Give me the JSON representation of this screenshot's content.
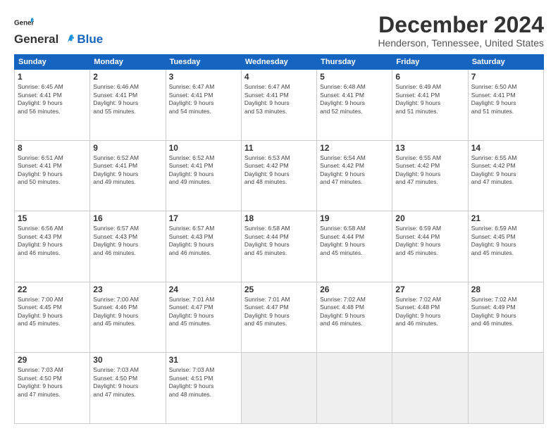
{
  "logo": {
    "general": "General",
    "blue": "Blue"
  },
  "title": {
    "month": "December 2024",
    "location": "Henderson, Tennessee, United States"
  },
  "weekdays": [
    "Sunday",
    "Monday",
    "Tuesday",
    "Wednesday",
    "Thursday",
    "Friday",
    "Saturday"
  ],
  "weeks": [
    [
      {
        "day": "1",
        "sunrise": "Sunrise: 6:45 AM",
        "sunset": "Sunset: 4:41 PM",
        "daylight": "Daylight: 9 hours and 56 minutes."
      },
      {
        "day": "2",
        "sunrise": "Sunrise: 6:46 AM",
        "sunset": "Sunset: 4:41 PM",
        "daylight": "Daylight: 9 hours and 55 minutes."
      },
      {
        "day": "3",
        "sunrise": "Sunrise: 6:47 AM",
        "sunset": "Sunset: 4:41 PM",
        "daylight": "Daylight: 9 hours and 54 minutes."
      },
      {
        "day": "4",
        "sunrise": "Sunrise: 6:47 AM",
        "sunset": "Sunset: 4:41 PM",
        "daylight": "Daylight: 9 hours and 53 minutes."
      },
      {
        "day": "5",
        "sunrise": "Sunrise: 6:48 AM",
        "sunset": "Sunset: 4:41 PM",
        "daylight": "Daylight: 9 hours and 52 minutes."
      },
      {
        "day": "6",
        "sunrise": "Sunrise: 6:49 AM",
        "sunset": "Sunset: 4:41 PM",
        "daylight": "Daylight: 9 hours and 51 minutes."
      },
      {
        "day": "7",
        "sunrise": "Sunrise: 6:50 AM",
        "sunset": "Sunset: 4:41 PM",
        "daylight": "Daylight: 9 hours and 51 minutes."
      }
    ],
    [
      {
        "day": "8",
        "sunrise": "Sunrise: 6:51 AM",
        "sunset": "Sunset: 4:41 PM",
        "daylight": "Daylight: 9 hours and 50 minutes."
      },
      {
        "day": "9",
        "sunrise": "Sunrise: 6:52 AM",
        "sunset": "Sunset: 4:41 PM",
        "daylight": "Daylight: 9 hours and 49 minutes."
      },
      {
        "day": "10",
        "sunrise": "Sunrise: 6:52 AM",
        "sunset": "Sunset: 4:41 PM",
        "daylight": "Daylight: 9 hours and 49 minutes."
      },
      {
        "day": "11",
        "sunrise": "Sunrise: 6:53 AM",
        "sunset": "Sunset: 4:42 PM",
        "daylight": "Daylight: 9 hours and 48 minutes."
      },
      {
        "day": "12",
        "sunrise": "Sunrise: 6:54 AM",
        "sunset": "Sunset: 4:42 PM",
        "daylight": "Daylight: 9 hours and 47 minutes."
      },
      {
        "day": "13",
        "sunrise": "Sunrise: 6:55 AM",
        "sunset": "Sunset: 4:42 PM",
        "daylight": "Daylight: 9 hours and 47 minutes."
      },
      {
        "day": "14",
        "sunrise": "Sunrise: 6:55 AM",
        "sunset": "Sunset: 4:42 PM",
        "daylight": "Daylight: 9 hours and 47 minutes."
      }
    ],
    [
      {
        "day": "15",
        "sunrise": "Sunrise: 6:56 AM",
        "sunset": "Sunset: 4:43 PM",
        "daylight": "Daylight: 9 hours and 46 minutes."
      },
      {
        "day": "16",
        "sunrise": "Sunrise: 6:57 AM",
        "sunset": "Sunset: 4:43 PM",
        "daylight": "Daylight: 9 hours and 46 minutes."
      },
      {
        "day": "17",
        "sunrise": "Sunrise: 6:57 AM",
        "sunset": "Sunset: 4:43 PM",
        "daylight": "Daylight: 9 hours and 46 minutes."
      },
      {
        "day": "18",
        "sunrise": "Sunrise: 6:58 AM",
        "sunset": "Sunset: 4:44 PM",
        "daylight": "Daylight: 9 hours and 45 minutes."
      },
      {
        "day": "19",
        "sunrise": "Sunrise: 6:58 AM",
        "sunset": "Sunset: 4:44 PM",
        "daylight": "Daylight: 9 hours and 45 minutes."
      },
      {
        "day": "20",
        "sunrise": "Sunrise: 6:59 AM",
        "sunset": "Sunset: 4:44 PM",
        "daylight": "Daylight: 9 hours and 45 minutes."
      },
      {
        "day": "21",
        "sunrise": "Sunrise: 6:59 AM",
        "sunset": "Sunset: 4:45 PM",
        "daylight": "Daylight: 9 hours and 45 minutes."
      }
    ],
    [
      {
        "day": "22",
        "sunrise": "Sunrise: 7:00 AM",
        "sunset": "Sunset: 4:45 PM",
        "daylight": "Daylight: 9 hours and 45 minutes."
      },
      {
        "day": "23",
        "sunrise": "Sunrise: 7:00 AM",
        "sunset": "Sunset: 4:46 PM",
        "daylight": "Daylight: 9 hours and 45 minutes."
      },
      {
        "day": "24",
        "sunrise": "Sunrise: 7:01 AM",
        "sunset": "Sunset: 4:47 PM",
        "daylight": "Daylight: 9 hours and 45 minutes."
      },
      {
        "day": "25",
        "sunrise": "Sunrise: 7:01 AM",
        "sunset": "Sunset: 4:47 PM",
        "daylight": "Daylight: 9 hours and 45 minutes."
      },
      {
        "day": "26",
        "sunrise": "Sunrise: 7:02 AM",
        "sunset": "Sunset: 4:48 PM",
        "daylight": "Daylight: 9 hours and 46 minutes."
      },
      {
        "day": "27",
        "sunrise": "Sunrise: 7:02 AM",
        "sunset": "Sunset: 4:48 PM",
        "daylight": "Daylight: 9 hours and 46 minutes."
      },
      {
        "day": "28",
        "sunrise": "Sunrise: 7:02 AM",
        "sunset": "Sunset: 4:49 PM",
        "daylight": "Daylight: 9 hours and 46 minutes."
      }
    ],
    [
      {
        "day": "29",
        "sunrise": "Sunrise: 7:03 AM",
        "sunset": "Sunset: 4:50 PM",
        "daylight": "Daylight: 9 hours and 47 minutes."
      },
      {
        "day": "30",
        "sunrise": "Sunrise: 7:03 AM",
        "sunset": "Sunset: 4:50 PM",
        "daylight": "Daylight: 9 hours and 47 minutes."
      },
      {
        "day": "31",
        "sunrise": "Sunrise: 7:03 AM",
        "sunset": "Sunset: 4:51 PM",
        "daylight": "Daylight: 9 hours and 48 minutes."
      },
      null,
      null,
      null,
      null
    ]
  ]
}
